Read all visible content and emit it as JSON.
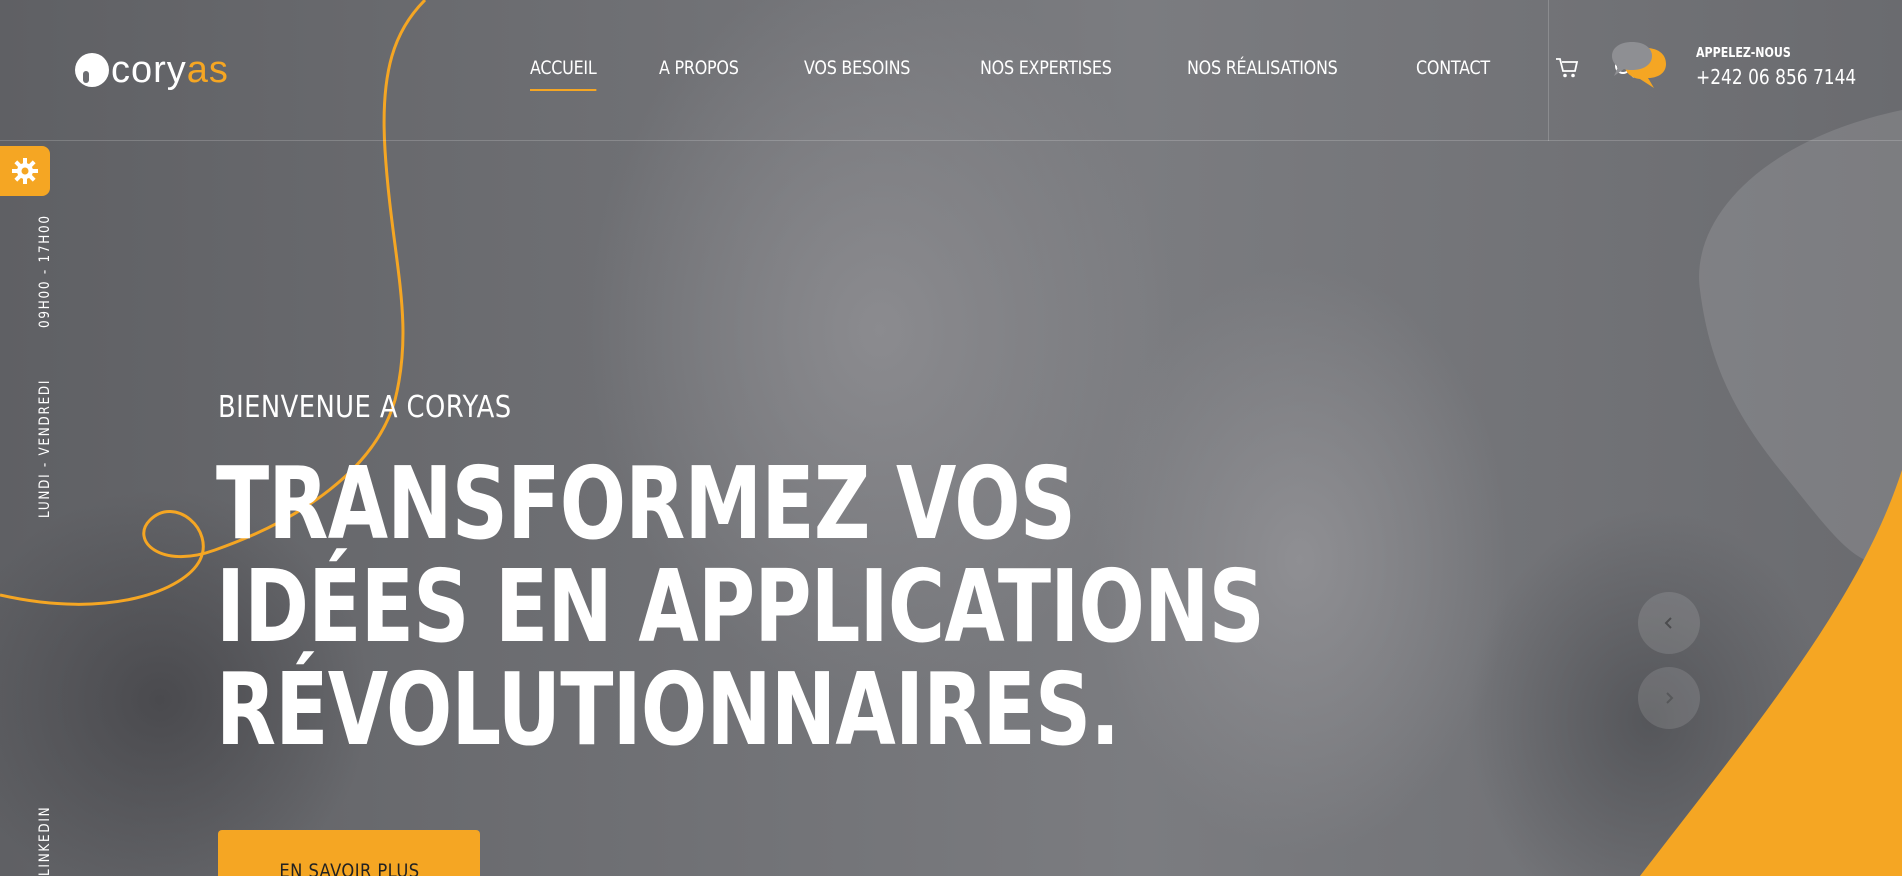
{
  "brand": {
    "logo_prefix": "cory",
    "logo_suffix": "as"
  },
  "nav": {
    "items": [
      {
        "label": "ACCUEIL",
        "active": true
      },
      {
        "label": "A PROPOS",
        "active": false
      },
      {
        "label": "VOS BESOINS",
        "active": false
      },
      {
        "label": "NOS EXPERTISES",
        "active": false
      },
      {
        "label": "NOS RÉALISATIONS",
        "active": false
      },
      {
        "label": "CONTACT",
        "active": false
      }
    ],
    "icons": [
      "cart-icon",
      "search-icon"
    ]
  },
  "contact": {
    "label": "APPELEZ-NOUS",
    "phone": "+242 06 856 7144",
    "icon": "chat-bubbles-icon"
  },
  "side": {
    "hours": "09H00 - 17H00",
    "days": "LUNDI - VENDREDI",
    "social": "LINKEDIN",
    "settings_icon": "gear-icon"
  },
  "hero": {
    "eyebrow": "BIENVENUE A CORYAS",
    "headline_lines": [
      "TRANSFORMEZ VOS",
      "IDÉES EN APPLICATIONS",
      "RÉVOLUTIONNAIRES."
    ],
    "cta_label": "EN SAVOIR PLUS"
  },
  "slider": {
    "prev_icon": "chevron-left-icon",
    "next_icon": "chevron-right-icon"
  },
  "colors": {
    "accent": "#f5a623",
    "overlay": "#6b6c70",
    "text": "#ffffff"
  }
}
